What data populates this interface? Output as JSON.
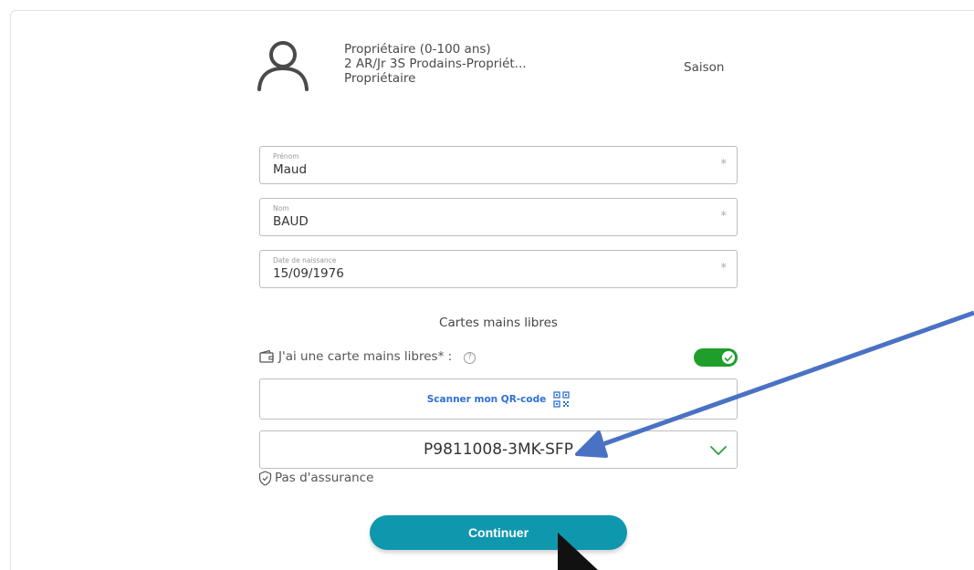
{
  "profile": {
    "category": "Propriétaire (0-100 ans)",
    "product": "2 AR/Jr 3S Prodains-Propriét...",
    "role": "Propriétaire",
    "season": "Saison",
    "avatar_icon": "user-icon"
  },
  "form": {
    "first_name": {
      "label": "Prénom",
      "value": "Maud",
      "required_mark": "*"
    },
    "last_name": {
      "label": "Nom",
      "value": "BAUD",
      "required_mark": "*"
    },
    "birth_date": {
      "label": "Date de naissance",
      "value": "15/09/1976",
      "required_mark": "*"
    }
  },
  "cards": {
    "section_title": "Cartes mains libres",
    "has_card_label": "J'ai une carte mains libres* :",
    "help_symbol": "?",
    "toggle_on": true,
    "scan_label": "Scanner mon QR-code",
    "card_number": "P9811008-3MK-SFP",
    "insurance_label": "Pas d'assurance"
  },
  "actions": {
    "continue_label": "Continuer"
  },
  "colors": {
    "toggle": "#1f9e2b",
    "continue_button": "#0f97ae",
    "qr_link": "#2f6fd6",
    "arrow_annotation": "#4a72c4",
    "valid_check": "#2f9e3a"
  }
}
